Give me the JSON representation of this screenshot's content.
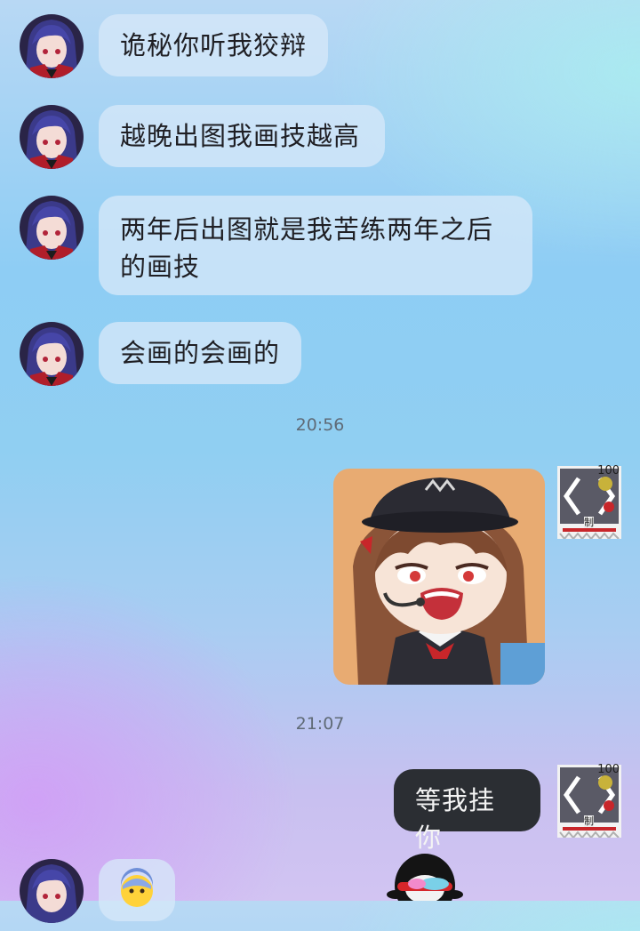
{
  "colors": {
    "incoming_bubble": "#d6e8f8",
    "outgoing_bubble": "#2b2e33",
    "timestamp_text": "#5f6a76"
  },
  "messages": [
    {
      "side": "incoming",
      "text": "诡秘你听我狡辩"
    },
    {
      "side": "incoming",
      "text": "越晚出图我画技越高"
    },
    {
      "side": "incoming",
      "text": "两年后出图就是我苦练两年之后的画技"
    },
    {
      "side": "incoming",
      "text": "会画的会画的"
    },
    {
      "type": "time",
      "text": "20:56"
    },
    {
      "side": "outgoing",
      "type": "sticker",
      "icon": "anime-girl-crying-sticker"
    },
    {
      "type": "time",
      "text": "21:07"
    },
    {
      "side": "outgoing",
      "text": "等我挂你"
    },
    {
      "side": "incoming",
      "type": "emoji",
      "icon": "fearful-face-emoji"
    },
    {
      "type": "bottom-icon",
      "icon": "qq-penguin-icon"
    }
  ],
  "card_avatar": {
    "number": "100",
    "badge": "制"
  }
}
